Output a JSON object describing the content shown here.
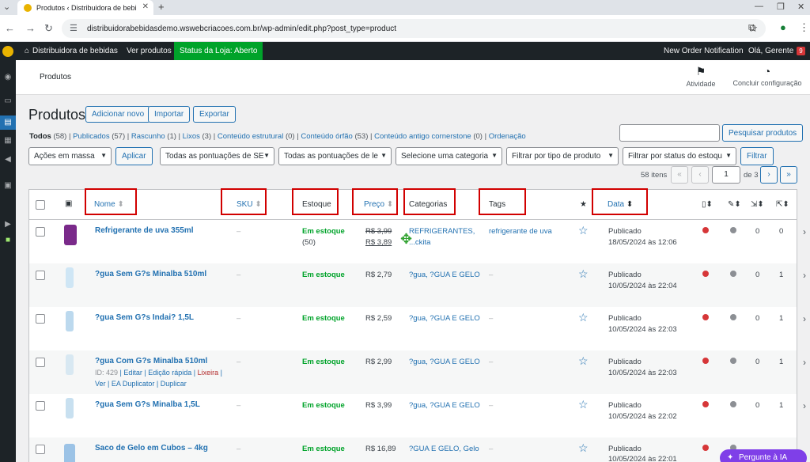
{
  "browser": {
    "tab_title": "Produtos ‹ Distribuidora de bebi",
    "url": "distribuidorabebidasdemo.wswebcriacoes.com.br/wp-admin/edit.php?post_type=product"
  },
  "adminbar": {
    "site": "Distribuidora de bebidas",
    "view_products": "Ver produtos",
    "store_status": "Status da Loja: Aberto",
    "new_order": "New Order Notification",
    "greeting": "Olá, Gerente",
    "badge": "9"
  },
  "header": {
    "title": "Produtos",
    "activity": "Atividade",
    "setup": "Concluir configuração"
  },
  "page": {
    "title": "Produtos",
    "add_new": "Adicionar novo",
    "import": "Importar",
    "export": "Exportar",
    "search_button": "Pesquisar produtos"
  },
  "subsub": [
    {
      "label": "Todos",
      "count": "(58)"
    },
    {
      "label": "Publicados",
      "count": "(57)"
    },
    {
      "label": "Rascunho",
      "count": "(1)"
    },
    {
      "label": "Lixos",
      "count": "(3)"
    },
    {
      "label": "Conteúdo estrutural",
      "count": "(0)"
    },
    {
      "label": "Conteúdo órfão",
      "count": "(53)"
    },
    {
      "label": "Conteúdo antigo cornerstone",
      "count": "(0)"
    },
    {
      "label": "Ordenação",
      "count": ""
    }
  ],
  "filters": {
    "bulk": "Ações em massa",
    "apply": "Aplicar",
    "seo": "Todas as pontuações de SE",
    "readability": "Todas as pontuações de le",
    "category": "Selecione uma categoria",
    "type": "Filtrar por tipo de produto",
    "stock": "Filtrar por status do estoqu",
    "filter": "Filtrar"
  },
  "pagination": {
    "items": "58 itens",
    "first": "«",
    "prev": "‹",
    "current": "1",
    "of": "de 3",
    "next": "›",
    "last": "»"
  },
  "columns": {
    "name": "Nome",
    "sku": "SKU",
    "stock": "Estoque",
    "price": "Preço",
    "categories": "Categorias",
    "tags": "Tags",
    "date": "Data"
  },
  "rows": [
    {
      "name": "Refrigerante de uva 355ml",
      "sku": "–",
      "stock": "Em estoque",
      "stock_qty": "(50)",
      "price_old": "R$ 3,99",
      "price": "R$ 3,89",
      "categories": "REFRIGERANTES,",
      "categories2": "...ckita",
      "tags": "refrigerante de uva",
      "status": "Publicado",
      "date": "18/05/2024 às 12:06",
      "n1": "0",
      "n2": "0",
      "thumb": "#7a2a8a"
    },
    {
      "name": "?gua Sem G?s Minalba 510ml",
      "sku": "–",
      "stock": "Em estoque",
      "price": "R$ 2,79",
      "categories": "?gua, ?GUA E GELO",
      "tags": "–",
      "status": "Publicado",
      "date": "10/05/2024 às 22:04",
      "n1": "0",
      "n2": "1",
      "thumb": "#cfe6f5"
    },
    {
      "name": "?gua Sem G?s Indai? 1,5L",
      "sku": "–",
      "stock": "Em estoque",
      "price": "R$ 2,59",
      "categories": "?gua, ?GUA E GELO",
      "tags": "–",
      "status": "Publicado",
      "date": "10/05/2024 às 22:03",
      "n1": "0",
      "n2": "1",
      "thumb": "#bcd9ee"
    },
    {
      "name": "?gua Com G?s Minalba 510ml",
      "sku": "–",
      "stock": "Em estoque",
      "price": "R$ 2,99",
      "categories": "?gua, ?GUA E GELO",
      "tags": "–",
      "status": "Publicado",
      "date": "10/05/2024 às 22:03",
      "n1": "0",
      "n2": "1",
      "thumb": "#d8e8f2",
      "actions": {
        "id": "ID: 429",
        "edit": "Editar",
        "quick": "Edição rápida",
        "trash": "Lixeira",
        "view": "Ver",
        "dup": "EA Duplicator",
        "dup2": "Duplicar"
      }
    },
    {
      "name": "?gua Sem G?s Minalba 1,5L",
      "sku": "–",
      "stock": "Em estoque",
      "price": "R$ 3,99",
      "categories": "?gua, ?GUA E GELO",
      "tags": "–",
      "status": "Publicado",
      "date": "10/05/2024 às 22:02",
      "n1": "0",
      "n2": "1",
      "thumb": "#c8e0f0"
    },
    {
      "name": "Saco de Gelo em Cubos – 4kg",
      "sku": "–",
      "stock": "Em estoque",
      "price": "R$ 16,89",
      "categories": "?GUA E GELO, Gelo",
      "tags": "–",
      "status": "Publicado",
      "date": "10/05/2024 às 22:01",
      "n1": "0",
      "n2": "1",
      "thumb": "#9cc3e6"
    }
  ],
  "ia_button": "Pergunte à IA"
}
